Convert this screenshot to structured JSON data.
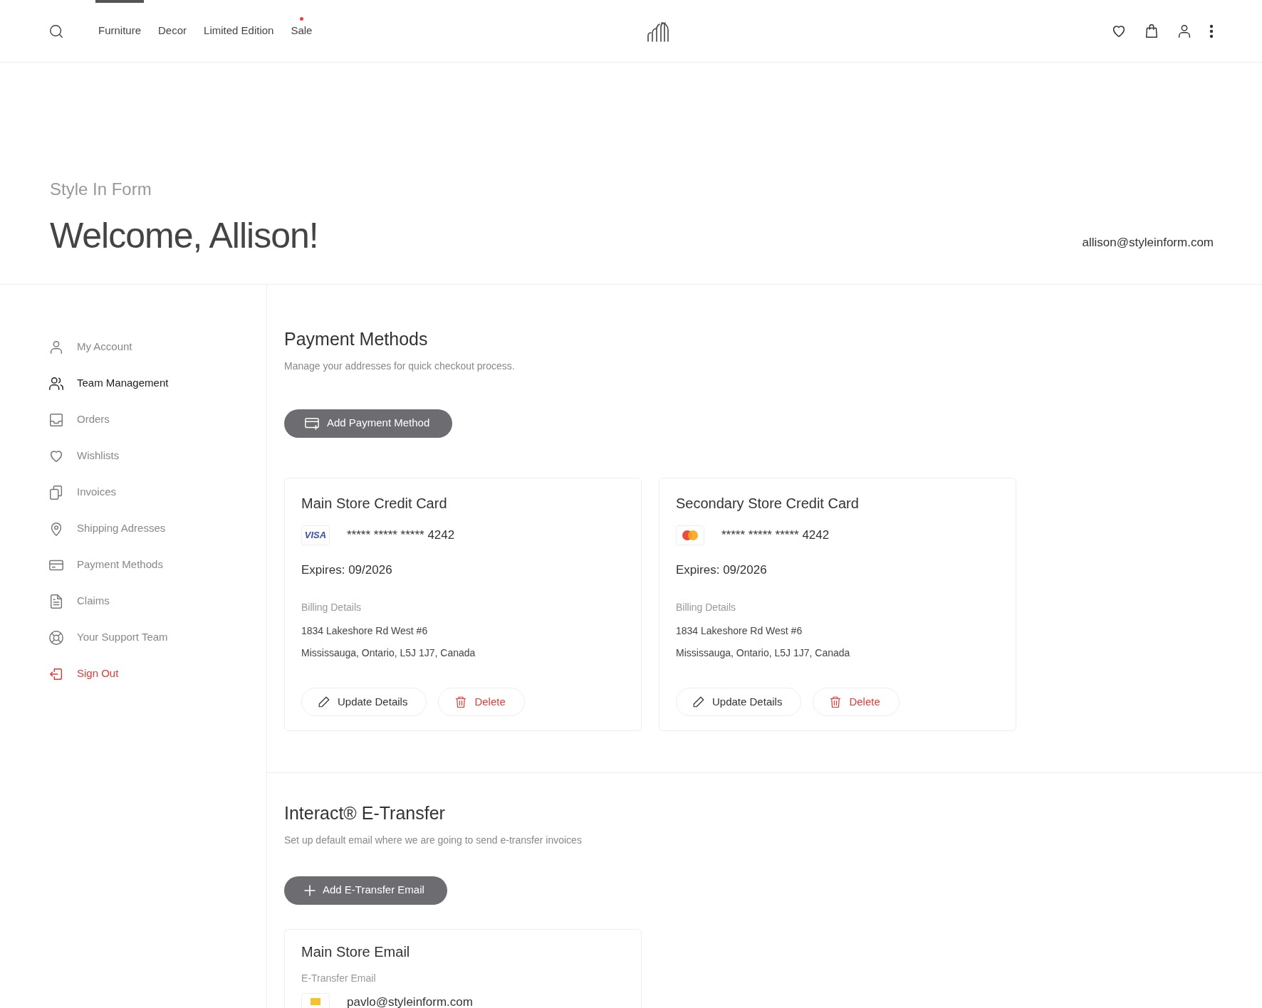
{
  "nav": {
    "items": [
      {
        "label": "Furniture",
        "selected": true,
        "dot": false
      },
      {
        "label": "Decor",
        "selected": false,
        "dot": false
      },
      {
        "label": "Limited Edition",
        "selected": false,
        "dot": false
      },
      {
        "label": "Sale",
        "selected": false,
        "dot": true
      }
    ]
  },
  "hero": {
    "brand": "Style In Form",
    "greeting": "Welcome, Allison!",
    "email": "allison@styleinform.com"
  },
  "sidebar": {
    "items": [
      {
        "label": "My Account",
        "selected": false,
        "kind": "link"
      },
      {
        "label": "Team Management",
        "selected": true,
        "kind": "link"
      },
      {
        "label": "Orders",
        "selected": false,
        "kind": "link"
      },
      {
        "label": "Wishlists",
        "selected": false,
        "kind": "link"
      },
      {
        "label": "Invoices",
        "selected": false,
        "kind": "link"
      },
      {
        "label": "Shipping Adresses",
        "selected": false,
        "kind": "link"
      },
      {
        "label": "Payment Methods",
        "selected": false,
        "kind": "link"
      },
      {
        "label": "Claims",
        "selected": false,
        "kind": "link"
      },
      {
        "label": "Your Support Team",
        "selected": false,
        "kind": "link"
      },
      {
        "label": "Sign Out",
        "selected": false,
        "kind": "danger"
      }
    ]
  },
  "payment_methods": {
    "title": "Payment Methods",
    "subtitle": "Manage your addresses for quick checkout process.",
    "add_button": "Add Payment Method",
    "cards": [
      {
        "title": "Main Store Credit Card",
        "kind": "visa",
        "brand_label": "VISA",
        "number": "***** ***** ***** 4242",
        "expires": "Expires: 09/2026",
        "billing_label": "Billing Details",
        "address_lines": [
          "1834 Lakeshore Rd West #6",
          "Mississauga, Ontario, L5J 1J7, Canada"
        ],
        "update_button": "Update Details",
        "delete_button": "Delete"
      },
      {
        "title": "Secondary Store Credit Card",
        "kind": "mastercard",
        "number": "***** ***** ***** 4242",
        "expires": "Expires: 09/2026",
        "billing_label": "Billing Details",
        "address_lines": [
          "1834 Lakeshore Rd West #6",
          "Mississauga, Ontario, L5J 1J7, Canada"
        ],
        "update_button": "Update Details",
        "delete_button": "Delete"
      }
    ]
  },
  "etransfer": {
    "title": "Interact® E-Transfer",
    "subtitle": "Set up default email where we are going to send e-transfer invoices",
    "add_button": "Add E-Transfer Email",
    "cards": [
      {
        "title": "Main Store Email",
        "label": "E-Transfer Email",
        "email": "pavlo@styleinform.com"
      }
    ]
  }
}
